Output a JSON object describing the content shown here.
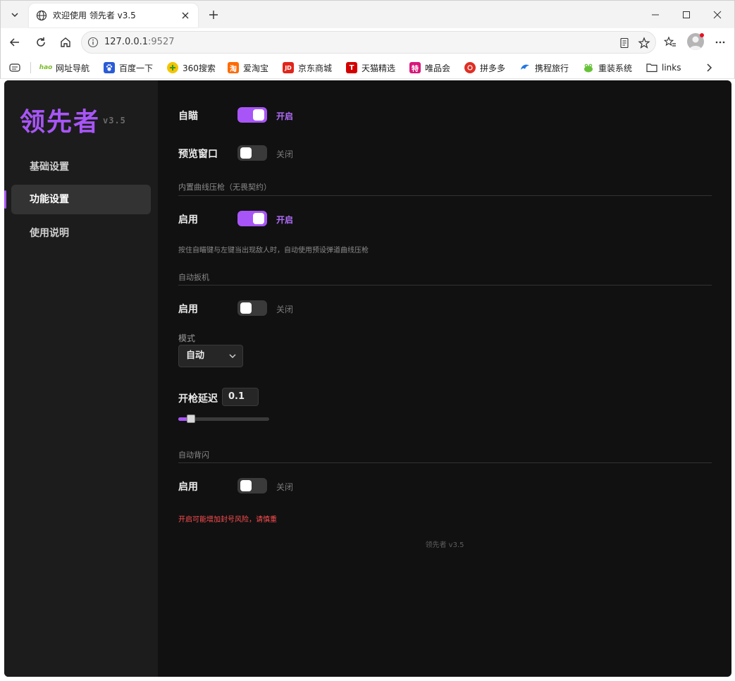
{
  "browser": {
    "tab_title": "欢迎使用 领先者 v3.5",
    "url_host": "127.0.0.1",
    "url_port": ":9527",
    "bookmarks": [
      {
        "label": "网址导航",
        "color": "#7dbb2f"
      },
      {
        "label": "百度一下",
        "color": "#2a5bd7"
      },
      {
        "label": "360搜索",
        "color": "#2f9a2f"
      },
      {
        "label": "爱淘宝",
        "color": "#ff6a00"
      },
      {
        "label": "京东商城",
        "color": "#e1251b"
      },
      {
        "label": "天猫精选",
        "color": "#d40000"
      },
      {
        "label": "唯品会",
        "color": "#d8177b"
      },
      {
        "label": "拼多多",
        "color": "#e02e24"
      },
      {
        "label": "携程旅行",
        "color": "#2577e3"
      },
      {
        "label": "重装系统",
        "color": "#67c23a"
      },
      {
        "label": "links",
        "color": "#444444"
      }
    ],
    "bookmark_badges": {
      "hao": "hao",
      "jd": "JD",
      "tmall": "T",
      "vip": "特",
      "taobao": "淘"
    }
  },
  "sidebar": {
    "brand": "领先者",
    "version": "v3.5",
    "items": [
      {
        "label": "基础设置"
      },
      {
        "label": "功能设置"
      },
      {
        "label": "使用说明"
      }
    ]
  },
  "main": {
    "aim": {
      "label": "自瞄",
      "state": "开启"
    },
    "preview": {
      "label": "预览窗口",
      "state": "关闭"
    },
    "recoil": {
      "section": "内置曲线压枪（无畏契约）",
      "label": "启用",
      "state": "开启",
      "hint": "按住自瞄键与左键当出现敌人时，自动使用预设弹道曲线压枪"
    },
    "trigger": {
      "section": "自动扳机",
      "label": "启用",
      "state": "关闭",
      "mode_label": "模式",
      "mode_value": "自动",
      "delay_label": "开枪延迟",
      "delay_value": "0.1",
      "delay_level": 0.14
    },
    "flash": {
      "section": "自动背闪",
      "label": "启用",
      "state": "关闭",
      "warning": "开启可能增加封号风险，请慎重"
    },
    "footer": "领先者 v3.5"
  },
  "colors": {
    "accent": "#a855f7",
    "warning": "#ff4d4f"
  }
}
